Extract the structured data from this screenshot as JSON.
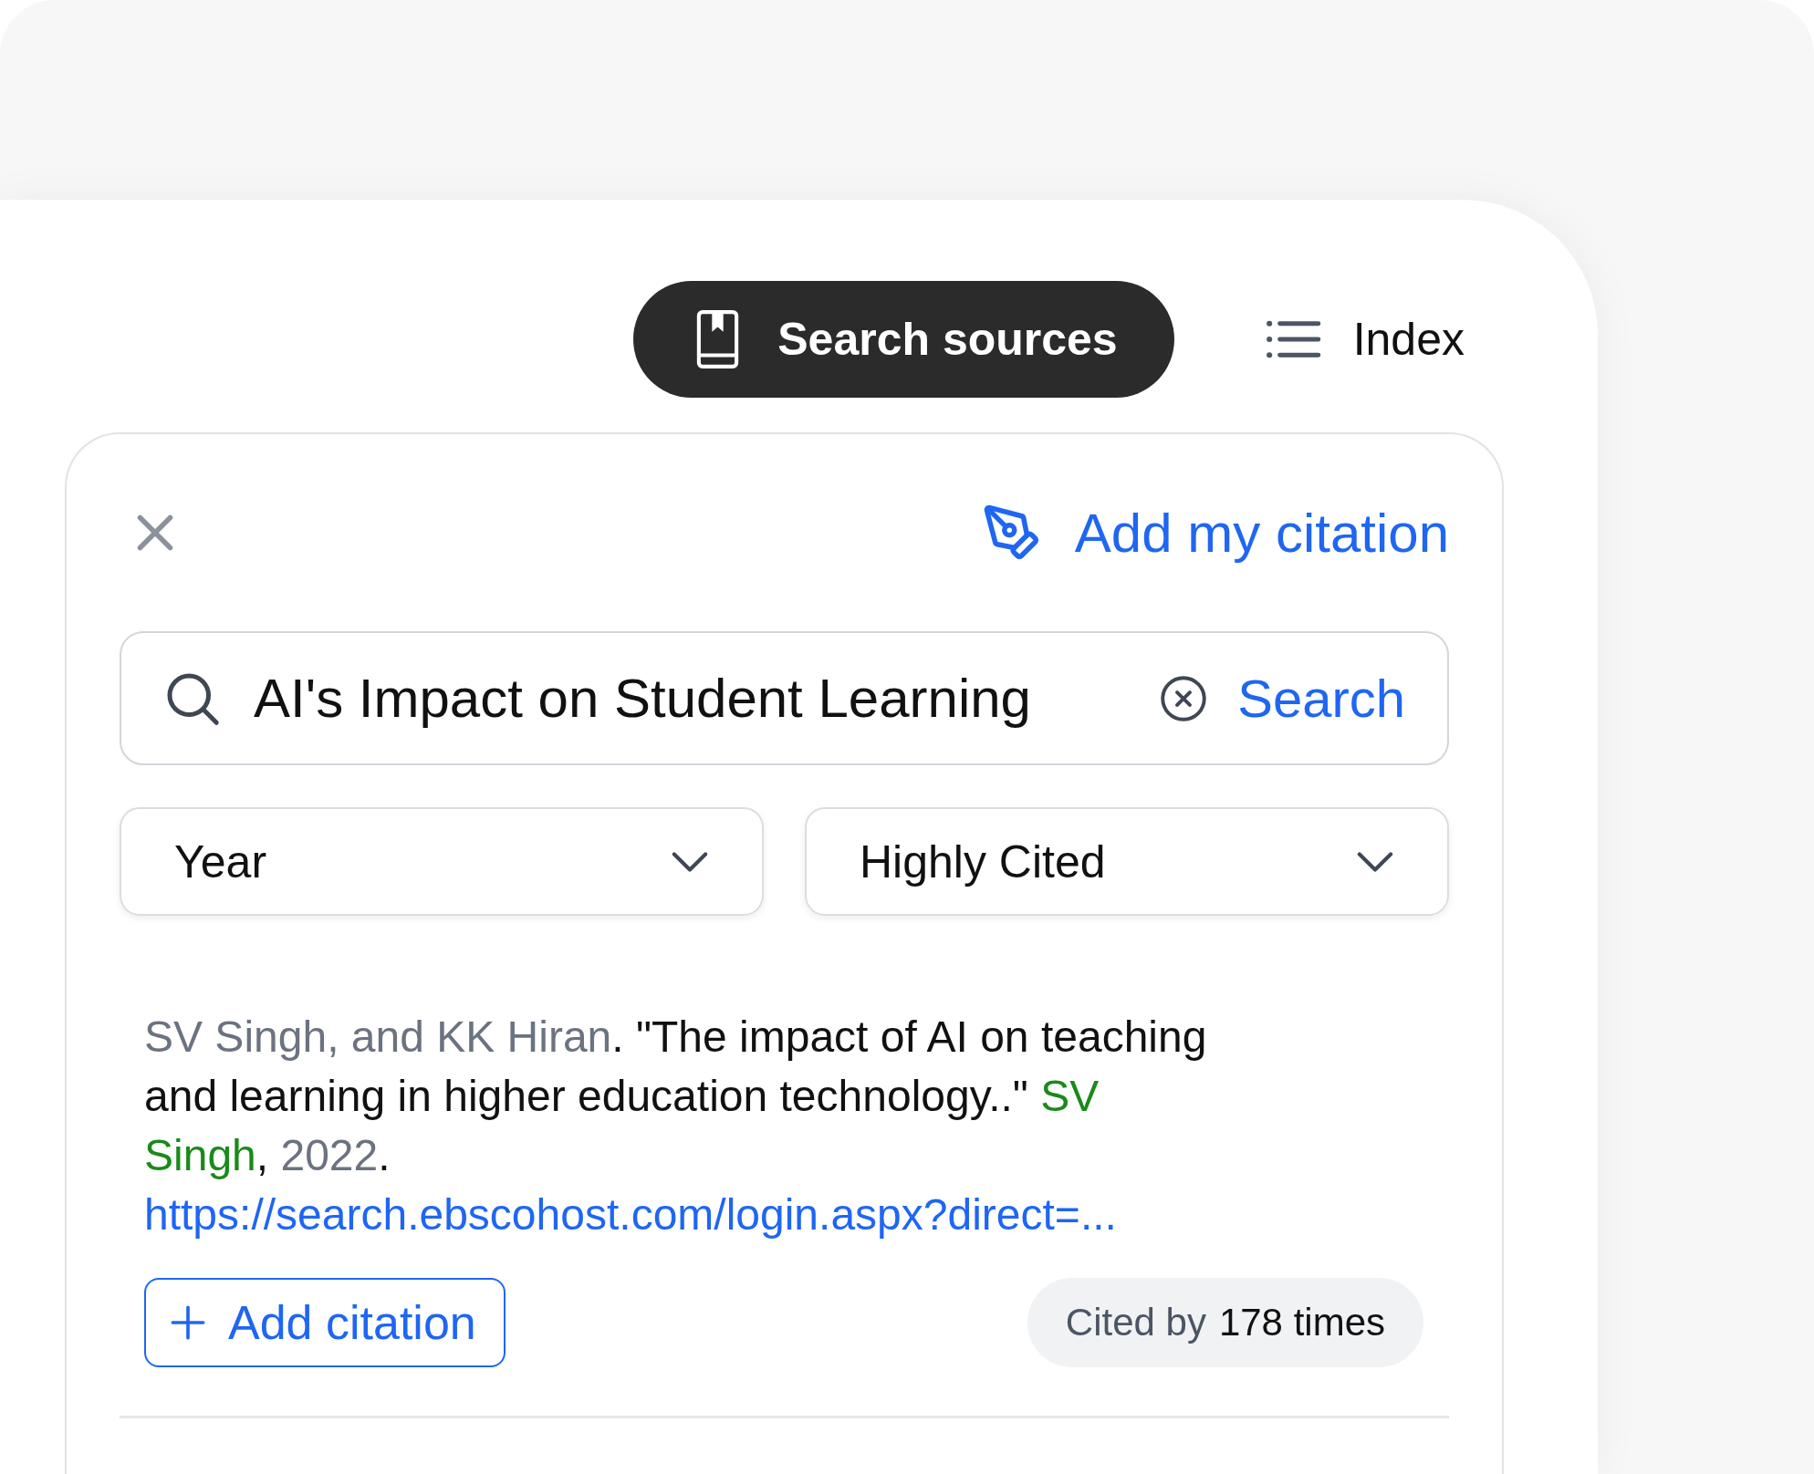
{
  "tabs": [
    {
      "label": "Search sources",
      "selected": true
    },
    {
      "label": "Index",
      "selected": false
    }
  ],
  "header": {
    "action": "Add my citation"
  },
  "search": {
    "value": "AI's Impact on Student Learning",
    "button": "Search"
  },
  "filters": [
    {
      "label": "Year"
    },
    {
      "label": "Highly Cited"
    }
  ],
  "results": [
    {
      "citation": [
        {
          "kind": "author",
          "text": "SV Singh, and KK Hiran"
        },
        {
          "kind": "plain",
          "text": ". \"The impact of AI on teaching and learning in higher education technology..\" "
        },
        {
          "kind": "source",
          "text": "SV Singh"
        },
        {
          "kind": "plain",
          "text": ", "
        },
        {
          "kind": "year",
          "text": "2022"
        },
        {
          "kind": "plain",
          "text": "."
        }
      ],
      "link": "https://search.ebscohost.com/login.aspx?direct=...",
      "add_button": "Add citation",
      "cited_label": "Cited by",
      "cited_count": "178 times"
    }
  ]
}
